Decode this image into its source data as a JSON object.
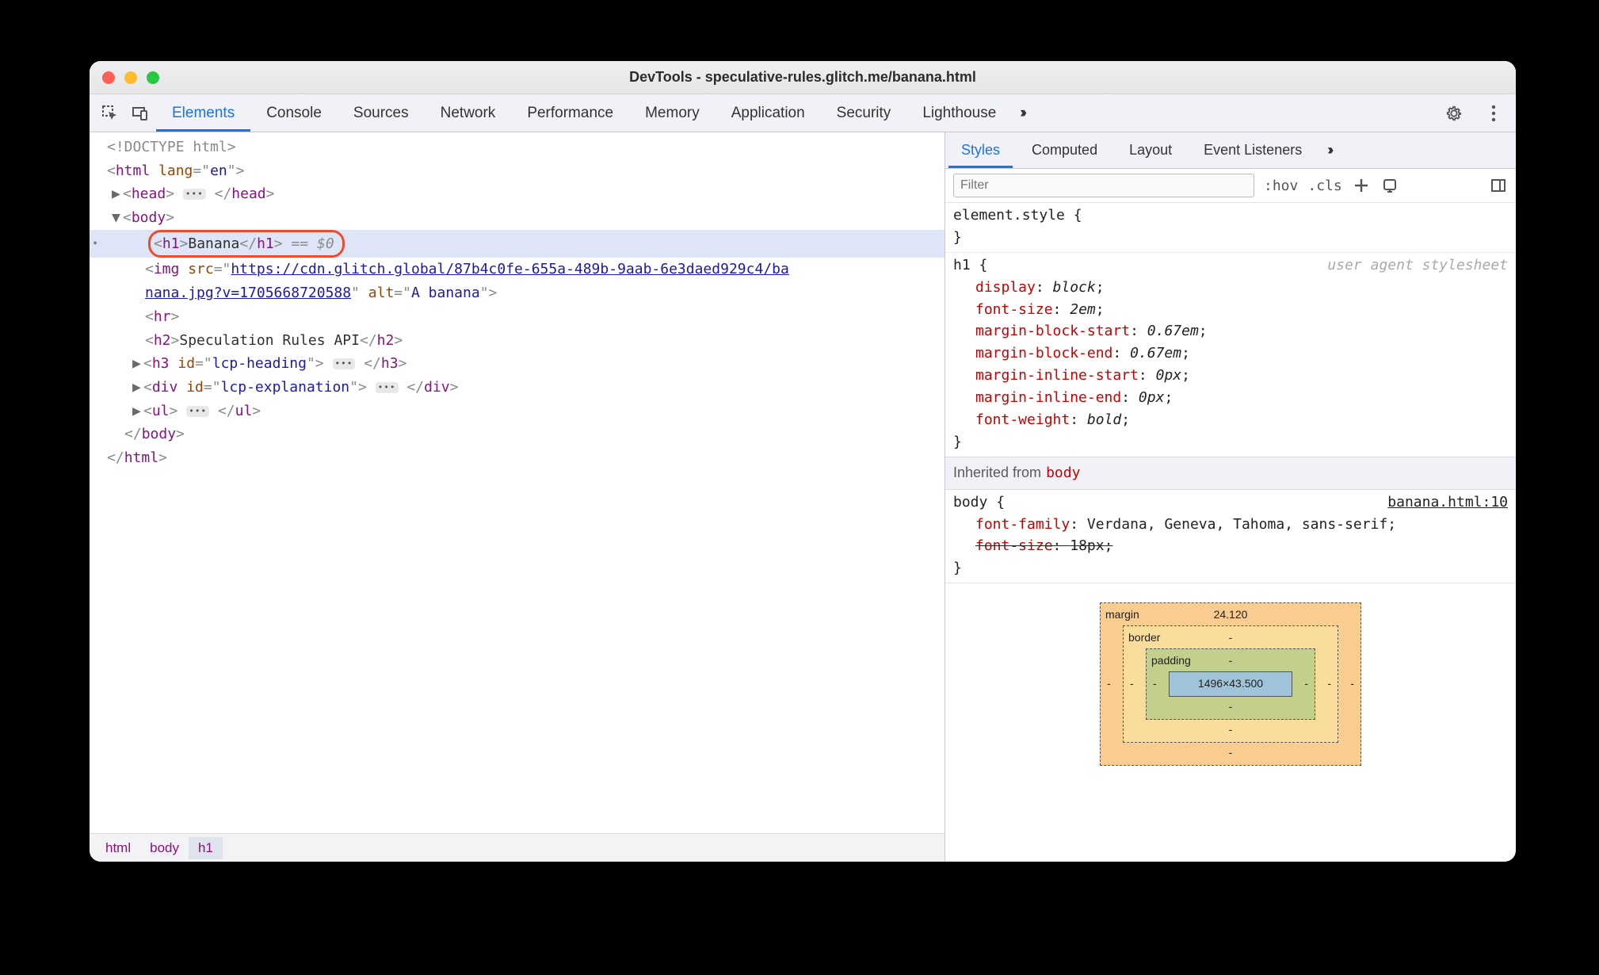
{
  "window": {
    "title": "DevTools - speculative-rules.glitch.me/banana.html"
  },
  "toolbar": {
    "tabs": [
      "Elements",
      "Console",
      "Sources",
      "Network",
      "Performance",
      "Memory",
      "Application",
      "Security",
      "Lighthouse"
    ],
    "active": 0,
    "more_glyph": "››"
  },
  "dom": {
    "doctype": "<!DOCTYPE html>",
    "html_open": {
      "tag": "html",
      "attrs": [
        [
          "lang",
          "en"
        ]
      ]
    },
    "head": {
      "tag": "head"
    },
    "body_open": {
      "tag": "body"
    },
    "selected": {
      "tag_open": "h1",
      "text": "Banana",
      "tag_close": "h1",
      "suffix": "== $0"
    },
    "img": {
      "tag": "img",
      "src_line1": "https://cdn.glitch.global/87b4c0fe-655a-489b-9aab-6e3daed929c4/ba",
      "src_line2": "nana.jpg?v=1705668720588",
      "alt": "A banana"
    },
    "hr": {
      "tag": "hr"
    },
    "h2": {
      "tag": "h2",
      "text": "Speculation Rules API"
    },
    "h3": {
      "tag": "h3",
      "attrs": [
        [
          "id",
          "lcp-heading"
        ]
      ]
    },
    "div": {
      "tag": "div",
      "attrs": [
        [
          "id",
          "lcp-explanation"
        ]
      ]
    },
    "ul": {
      "tag": "ul"
    },
    "body_close": "body",
    "html_close": "html"
  },
  "breadcrumb": [
    "html",
    "body",
    "h1"
  ],
  "side": {
    "tabs": [
      "Styles",
      "Computed",
      "Layout",
      "Event Listeners"
    ],
    "active": 0,
    "more_glyph": "››",
    "filter_placeholder": "Filter",
    "hov": ":hov",
    "cls": ".cls"
  },
  "styles": {
    "element_style_sel": "element.style",
    "h1": {
      "selector": "h1",
      "ua_note": "user agent stylesheet",
      "decls": [
        [
          "display",
          "block"
        ],
        [
          "font-size",
          "2em"
        ],
        [
          "margin-block-start",
          "0.67em"
        ],
        [
          "margin-block-end",
          "0.67em"
        ],
        [
          "margin-inline-start",
          "0px"
        ],
        [
          "margin-inline-end",
          "0px"
        ],
        [
          "font-weight",
          "bold"
        ]
      ]
    },
    "inherit_label": "Inherited from",
    "inherit_from": "body",
    "body_rule": {
      "selector": "body",
      "src": "banana.html:10",
      "decls": [
        [
          "font-family",
          "Verdana, Geneva, Tahoma, sans-serif",
          false
        ],
        [
          "font-size",
          "18px",
          true
        ]
      ]
    }
  },
  "boxmodel": {
    "margin": {
      "label": "margin",
      "t": "24.120",
      "r": "-",
      "b": "-",
      "l": "-"
    },
    "border": {
      "label": "border",
      "t": "-",
      "r": "-",
      "b": "-",
      "l": "-"
    },
    "padding": {
      "label": "padding",
      "t": "-",
      "r": "-",
      "b": "-",
      "l": "-"
    },
    "content": "1496×43.500"
  }
}
